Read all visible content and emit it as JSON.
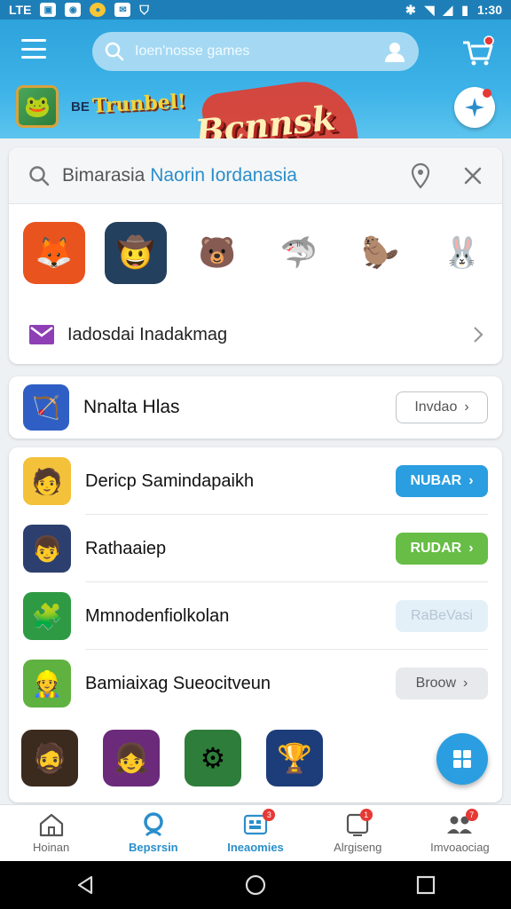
{
  "status_bar": {
    "time": "1:30",
    "left_icons": [
      "LTE",
      "msg-icon",
      "app-icon",
      "coin-icon",
      "mail-icon",
      "shield-icon"
    ],
    "right_icons": [
      "bluetooth-icon",
      "wifi-icon",
      "signal-icon",
      "battery-icon"
    ]
  },
  "header": {
    "search_placeholder": "Ioen'nosse games",
    "banner_small_text": "BE",
    "banner_logo_1": "Trunbel!",
    "banner_logo_2": "Bcnnsk",
    "colors": {
      "bar": "#2ea3dc",
      "accent_red": "#e23b2c"
    }
  },
  "search_card": {
    "query_plain": "Bimarasia ",
    "query_highlight": "Naorin Iordanasia",
    "games": [
      {
        "name": "fox-game-icon",
        "bg": "#e9531e",
        "glyph": "🦊"
      },
      {
        "name": "cowboy-game-icon",
        "bg": "#23405e",
        "glyph": "🤠"
      },
      {
        "name": "orange-creature-game-icon",
        "bg": "#ffffff",
        "glyph": "🐻"
      },
      {
        "name": "shark-game-icon",
        "bg": "#ffffff",
        "glyph": "🦈"
      },
      {
        "name": "beaver-game-icon",
        "bg": "#ffffff",
        "glyph": "🦫"
      },
      {
        "name": "bunny-game-icon",
        "bg": "#ffffff",
        "glyph": "🐰"
      }
    ],
    "link_label": "Iadosdai Inadakmag"
  },
  "featured_row": {
    "title": "Nnalta Hlas",
    "button": "Invdao"
  },
  "list": [
    {
      "title": "Dericp Samindapaikh",
      "button": "NUBAR",
      "style": "blue",
      "icon_bg": "#f3c13a",
      "glyph": "🧑"
    },
    {
      "title": "Rathaaiep",
      "button": "RUDAR",
      "style": "green",
      "icon_bg": "#2d3f6e",
      "glyph": "👦"
    },
    {
      "title": "Mmnodenfiolkolan",
      "button": "RaBeVasi",
      "style": "pale",
      "icon_bg": "#2f9a44",
      "glyph": "🧩"
    },
    {
      "title": "Bamiaixag Sueocitveun",
      "button": "Broow",
      "style": "grey",
      "icon_bg": "#5fb23f",
      "glyph": "👷"
    }
  ],
  "bottom_games": [
    {
      "name": "bearded-hero-game-icon",
      "bg": "#3b2a1e",
      "glyph": "🧔"
    },
    {
      "name": "girl-hero-game-icon",
      "bg": "#6b2b7a",
      "glyph": "👧"
    },
    {
      "name": "machine-game-icon",
      "bg": "#2e7d3a",
      "glyph": "⚙"
    },
    {
      "name": "cup-game-icon",
      "bg": "#1d3d7a",
      "glyph": "🏆"
    }
  ],
  "nav": [
    {
      "label": "Hoinan",
      "icon": "home-icon",
      "badge": ""
    },
    {
      "label": "Bepsrsin",
      "icon": "search-person-icon",
      "badge": ""
    },
    {
      "label": "Ineaomies",
      "icon": "game-grid-icon",
      "badge": "3"
    },
    {
      "label": "Alrgiseng",
      "icon": "tablet-icon",
      "badge": "1"
    },
    {
      "label": "Imvoaociag",
      "icon": "people-icon",
      "badge": "7"
    }
  ],
  "nav_active": "Ineaomies"
}
